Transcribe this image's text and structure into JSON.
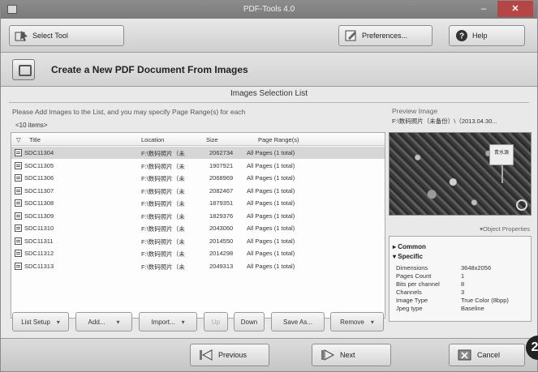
{
  "window": {
    "title": "PDF-Tools 4.0",
    "minimize": "–",
    "close": "✕"
  },
  "toolbar": {
    "select_tool": "Select Tool",
    "preferences": "Preferences...",
    "help": "Help"
  },
  "banner": {
    "title": "Create a New PDF Document From Images"
  },
  "list_section": {
    "title": "Images Selection List",
    "hint": "Please Add Images to the List, and you may specify Page Range(s) for each",
    "count": "<10 items>",
    "columns": {
      "title": "Title",
      "location": "Location",
      "size": "Size",
      "page_range": "Page Range(s)"
    },
    "rows": [
      {
        "title": "SDC11304",
        "location": "F:\\数码照片（未",
        "size": "2062734",
        "pages": "All Pages (1 total)"
      },
      {
        "title": "SDC11305",
        "location": "F:\\数码照片（未",
        "size": "1907921",
        "pages": "All Pages (1 total)"
      },
      {
        "title": "SDC11306",
        "location": "F:\\数码照片（未",
        "size": "2068969",
        "pages": "All Pages (1 total)"
      },
      {
        "title": "SDC11307",
        "location": "F:\\数码照片（未",
        "size": "2082467",
        "pages": "All Pages (1 total)"
      },
      {
        "title": "SDC11308",
        "location": "F:\\数码照片（未",
        "size": "1879351",
        "pages": "All Pages (1 total)"
      },
      {
        "title": "SDC11309",
        "location": "F:\\数码照片（未",
        "size": "1829376",
        "pages": "All Pages (1 total)"
      },
      {
        "title": "SDC11310",
        "location": "F:\\数码照片（未",
        "size": "2043060",
        "pages": "All Pages (1 total)"
      },
      {
        "title": "SDC11311",
        "location": "F:\\数码照片（未",
        "size": "2014550",
        "pages": "All Pages (1 total)"
      },
      {
        "title": "SDC11312",
        "location": "F:\\数码照片（未",
        "size": "2014298",
        "pages": "All Pages (1 total)"
      },
      {
        "title": "SDC11313",
        "location": "F:\\数码照片（未",
        "size": "2049313",
        "pages": "All Pages (1 total)"
      }
    ]
  },
  "preview": {
    "label": "Preview Image",
    "path": "F:\\数码照片（未备份）\\（2013.04.30...",
    "sign_text": "青水源"
  },
  "properties": {
    "link": "▾Object Properties",
    "common": "▸ Common",
    "specific": "▾ Specific",
    "items": [
      {
        "key": "Dimensions",
        "value": "3648x2056"
      },
      {
        "key": "Pages Count",
        "value": "1"
      },
      {
        "key": "Bits per channel",
        "value": "8"
      },
      {
        "key": "Channels",
        "value": "3"
      },
      {
        "key": "Image Type",
        "value": "True Color (8bpp)"
      },
      {
        "key": "Jpeg type",
        "value": "Baseline"
      }
    ]
  },
  "list_buttons": {
    "list_setup": "List Setup",
    "add": "Add...",
    "import": "Import...",
    "up": "Up",
    "down": "Down",
    "save_as": "Save As...",
    "remove": "Remove",
    "dropdown": "▾"
  },
  "footer": {
    "previous": "Previous",
    "next": "Next",
    "cancel": "Cancel",
    "corner_badge": "2"
  }
}
